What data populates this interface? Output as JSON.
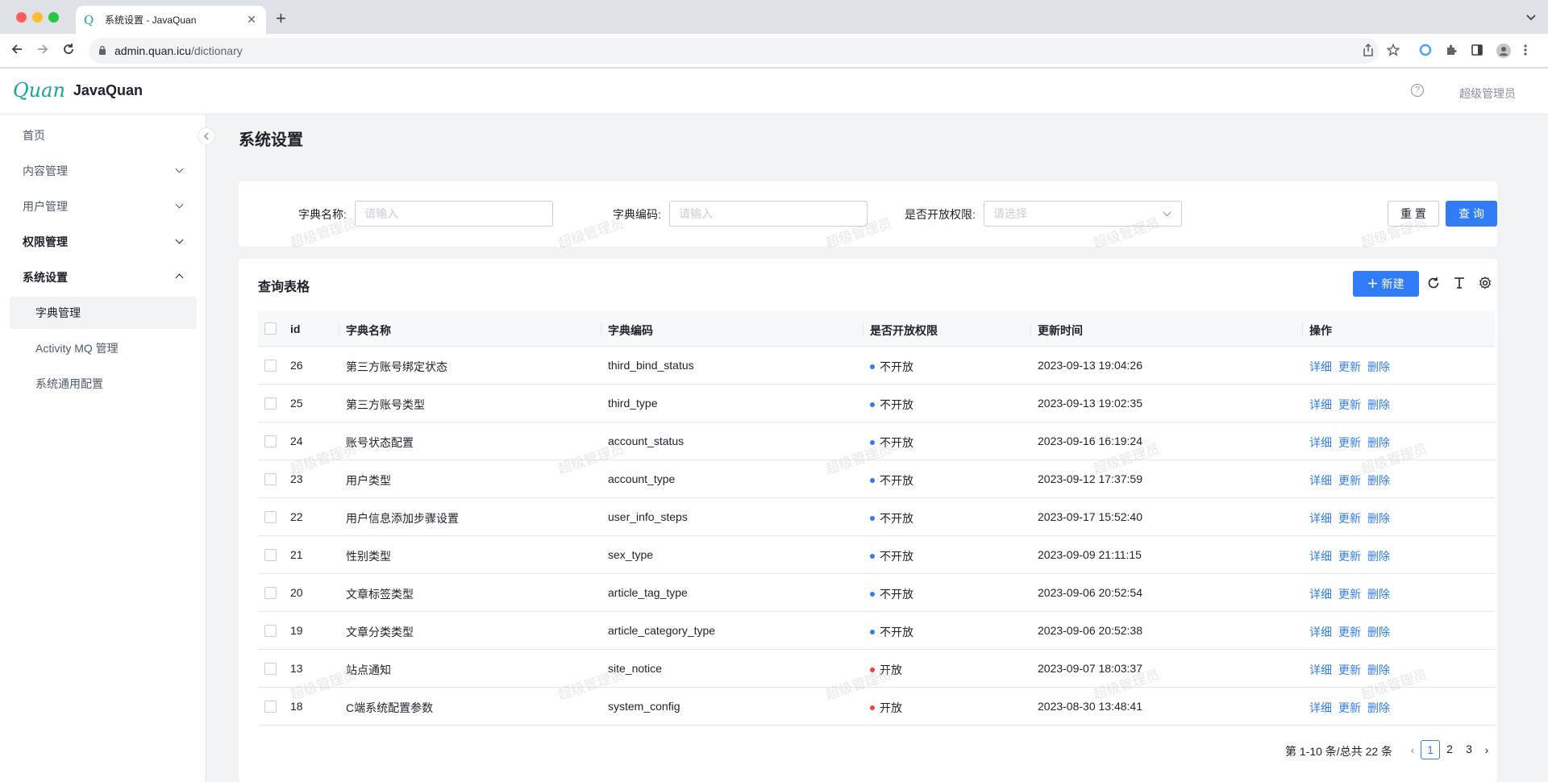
{
  "browser": {
    "tab_title": "系统设置 - JavaQuan",
    "favicon": "Q",
    "close_glyph": "✕",
    "new_tab_glyph": "+",
    "url_host": "admin.quan.icu",
    "url_path": "/dictionary"
  },
  "app": {
    "logo_script": "Quan",
    "logo_name": "JavaQuan",
    "help_glyph": "?",
    "user_label": "超级管理员",
    "page_title": "系统设置",
    "watermark": "超级管理员"
  },
  "sidebar": {
    "items": [
      {
        "label": "首页"
      },
      {
        "label": "内容管理"
      },
      {
        "label": "用户管理"
      },
      {
        "label": "权限管理"
      },
      {
        "label": "系统设置"
      },
      {
        "label": "字典管理"
      },
      {
        "label": "Activity MQ 管理"
      },
      {
        "label": "系统通用配置"
      }
    ]
  },
  "filter": {
    "name_label": "字典名称:",
    "name_placeholder": "请输入",
    "code_label": "字典编码:",
    "code_placeholder": "请输入",
    "open_label": "是否开放权限:",
    "open_placeholder": "请选择",
    "reset_label": "重 置",
    "search_label": "查 询"
  },
  "table": {
    "title": "查询表格",
    "new_label": "新建",
    "columns": [
      "id",
      "字典名称",
      "字典编码",
      "是否开放权限",
      "更新时间",
      "操作"
    ],
    "actions": [
      "详细",
      "更新",
      "删除"
    ],
    "status_colors": {
      "closed": "#2f7cf6",
      "open": "#f53f3f"
    },
    "rows": [
      {
        "id": "26",
        "name": "第三方账号绑定状态",
        "code": "third_bind_status",
        "open": "不开放",
        "time": "2023-09-13 19:04:26"
      },
      {
        "id": "25",
        "name": "第三方账号类型",
        "code": "third_type",
        "open": "不开放",
        "time": "2023-09-13 19:02:35"
      },
      {
        "id": "24",
        "name": "账号状态配置",
        "code": "account_status",
        "open": "不开放",
        "time": "2023-09-16 16:19:24"
      },
      {
        "id": "23",
        "name": "用户类型",
        "code": "account_type",
        "open": "不开放",
        "time": "2023-09-12 17:37:59"
      },
      {
        "id": "22",
        "name": "用户信息添加步骤设置",
        "code": "user_info_steps",
        "open": "不开放",
        "time": "2023-09-17 15:52:40"
      },
      {
        "id": "21",
        "name": "性别类型",
        "code": "sex_type",
        "open": "不开放",
        "time": "2023-09-09 21:11:15"
      },
      {
        "id": "20",
        "name": "文章标签类型",
        "code": "article_tag_type",
        "open": "不开放",
        "time": "2023-09-06 20:52:54"
      },
      {
        "id": "19",
        "name": "文章分类类型",
        "code": "article_category_type",
        "open": "不开放",
        "time": "2023-09-06 20:52:38"
      },
      {
        "id": "13",
        "name": "站点通知",
        "code": "site_notice",
        "open": "开放",
        "time": "2023-09-07 18:03:37"
      },
      {
        "id": "18",
        "name": "C端系统配置参数",
        "code": "system_config",
        "open": "开放",
        "time": "2023-08-30 13:48:41"
      }
    ]
  },
  "pagination": {
    "total_text": "第 1-10 条/总共 22 条",
    "pages": [
      "1",
      "2",
      "3"
    ],
    "current": "1",
    "prev_glyph": "‹",
    "next_glyph": "›"
  },
  "colors": {
    "primary": "#2f7cf6",
    "accent_logo": "#1aa39a"
  }
}
